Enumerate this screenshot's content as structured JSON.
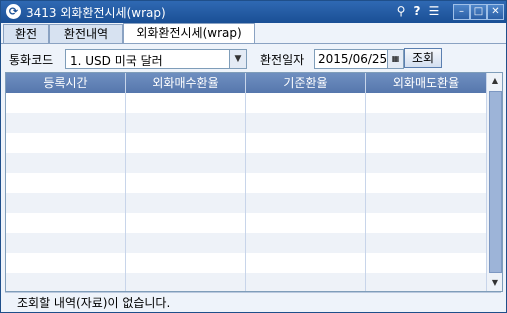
{
  "window": {
    "title": "3413 외화환전시세(wrap)",
    "icons": [
      "pin-icon",
      "help-icon",
      "menu-icon",
      "minimize-icon",
      "maximize-icon",
      "close-icon"
    ]
  },
  "tabs": [
    {
      "label": "환전",
      "active": false
    },
    {
      "label": "환전내역",
      "active": false
    },
    {
      "label": "외화환전시세(wrap)",
      "active": true
    }
  ],
  "toolbar": {
    "currency_label": "통화코드",
    "currency_value": "1. USD  미국 달러",
    "date_label": "환전일자",
    "date_value": "2015/06/25",
    "query_button": "조회"
  },
  "table": {
    "columns": [
      "등록시간",
      "외화매수환율",
      "기준환율",
      "외화매도환율"
    ],
    "rows": []
  },
  "status": {
    "message": "조회할 내역(자료)이 없습니다."
  },
  "colors": {
    "titlebar": "#2f69b3",
    "header": "#5677ad",
    "stripe": "#eef2f8"
  }
}
